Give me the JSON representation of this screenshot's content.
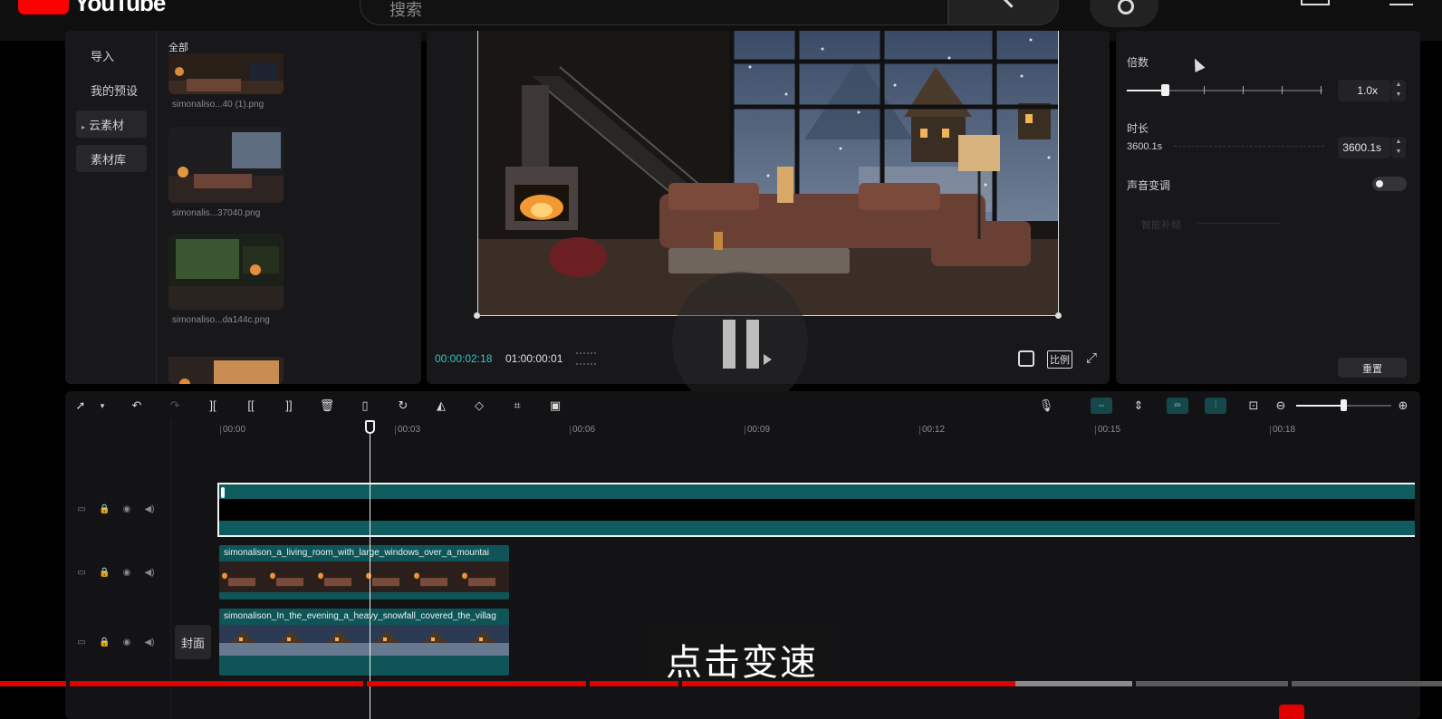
{
  "youtube": {
    "logo_text": "YouTube",
    "search_placeholder": "搜索"
  },
  "media": {
    "nav": [
      {
        "label": "导入"
      },
      {
        "label": "我的预设"
      },
      {
        "label": "云素材"
      },
      {
        "label": "素材库"
      }
    ],
    "all_label": "全部",
    "files": [
      {
        "name": "simonaliso...40 (1).png"
      },
      {
        "name": "simonalis...37040.png"
      },
      {
        "name": "simonaliso...da144c.png"
      },
      {
        "name": ""
      }
    ]
  },
  "player": {
    "current_time": "00:00:02:18",
    "total_time": "01:00:00:01",
    "ratio_label": "比例"
  },
  "properties": {
    "speed_label": "倍数",
    "speed_value": "1.0x",
    "duration_label": "时长",
    "duration_left": "3600.1s",
    "duration_value": "3600.1s",
    "pitch_label": "声音变调",
    "pitch_enabled": false,
    "smart_fill_label": "智能补帧",
    "reset_label": "重置",
    "speed_slider_fraction": 0.2
  },
  "timeline": {
    "ruler_marks": [
      "00:00",
      "00:03",
      "00:06",
      "00:09",
      "00:12",
      "00:15",
      "00:18"
    ],
    "tracks": [
      {
        "clip_title": ""
      },
      {
        "clip_title": "simonalison_a_living_room_with_large_windows_over_a_mountai"
      },
      {
        "clip_title": "simonalison_In_the_evening_a_heavy_snowfall_covered_the_villag"
      }
    ],
    "cover_label": "封面"
  },
  "caption": "点击变速",
  "colors": {
    "accent_teal": "#2ec6c2",
    "clip_teal": "#0f5457",
    "youtube_red": "#ff0000"
  }
}
